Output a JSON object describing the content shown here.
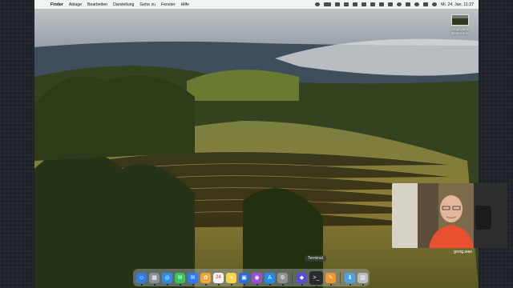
{
  "menubar": {
    "app_name": "Finder",
    "menus": [
      "Ablage",
      "Bearbeiten",
      "Darstellung",
      "Gehe zu",
      "Fenster",
      "Hilfe"
    ],
    "clock": "Mi. 24. Jan.  11:27"
  },
  "desktop_file": {
    "name": "Programme starten.mov"
  },
  "dock": {
    "tooltip": "Terminal",
    "apps": [
      {
        "name": "finder-icon",
        "color": "#2f7de1",
        "glyph": "☺"
      },
      {
        "name": "launchpad-icon",
        "color": "#8a8f99",
        "glyph": "▦"
      },
      {
        "name": "safari-icon",
        "color": "#2a8ee8",
        "glyph": "◎"
      },
      {
        "name": "messages-icon",
        "color": "#34c759",
        "glyph": "✉"
      },
      {
        "name": "mail-icon",
        "color": "#2c7bf6",
        "glyph": "✉"
      },
      {
        "name": "photos-icon",
        "color": "#f2a43a",
        "glyph": "✿"
      },
      {
        "name": "calendar-icon",
        "color": "#f3f3f3",
        "glyph": "24"
      },
      {
        "name": "notes-icon",
        "color": "#f6d54a",
        "glyph": "≡"
      },
      {
        "name": "keynote-icon",
        "color": "#2e6bd8",
        "glyph": "▣"
      },
      {
        "name": "podcasts-icon",
        "color": "#9b4fd8",
        "glyph": "◉"
      },
      {
        "name": "app-store-icon",
        "color": "#1f8cf0",
        "glyph": "A"
      },
      {
        "name": "system-settings-icon",
        "color": "#8e8e93",
        "glyph": "⚙"
      }
    ],
    "recent_apps": [
      {
        "name": "shortcuts-icon",
        "color": "#5b4bd6",
        "glyph": "◆"
      },
      {
        "name": "terminal-icon",
        "color": "#2b2b2b",
        "glyph": ">_",
        "active": true
      },
      {
        "name": "pages-icon",
        "color": "#f3962f",
        "glyph": "✎"
      }
    ],
    "trailing": [
      {
        "name": "downloads-folder-icon",
        "color": "#4aa3e8",
        "glyph": "⬇"
      },
      {
        "name": "trash-icon",
        "color": "#b9bdc2",
        "glyph": "▥"
      }
    ]
  },
  "webcam": {
    "label": "gong.wav"
  }
}
